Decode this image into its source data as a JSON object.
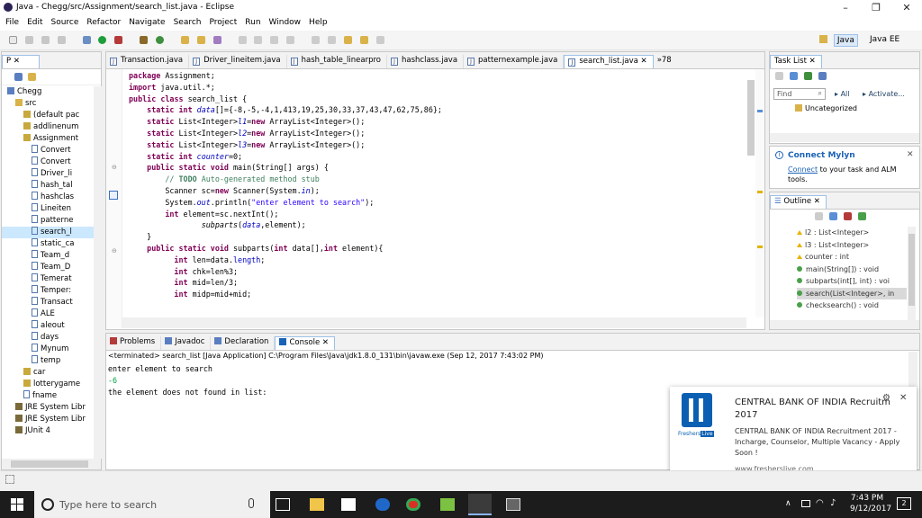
{
  "window": {
    "title": "Java - Chegg/src/Assignment/search_list.java - Eclipse"
  },
  "menu": [
    "File",
    "Edit",
    "Source",
    "Refactor",
    "Navigate",
    "Search",
    "Project",
    "Run",
    "Window",
    "Help"
  ],
  "perspectives": {
    "java": "Java",
    "javaee": "Java EE"
  },
  "explorer": {
    "tab": "P",
    "items": [
      {
        "label": "Chegg",
        "type": "project",
        "indent": 0
      },
      {
        "label": "src",
        "type": "folder",
        "indent": 1
      },
      {
        "label": "(default pac",
        "type": "package",
        "indent": 2
      },
      {
        "label": "addlinenum",
        "type": "package",
        "indent": 2
      },
      {
        "label": "Assignment",
        "type": "package",
        "indent": 2
      },
      {
        "label": "Convert",
        "type": "file",
        "indent": 3
      },
      {
        "label": "Convert",
        "type": "file",
        "indent": 3
      },
      {
        "label": "Driver_li",
        "type": "file",
        "indent": 3
      },
      {
        "label": "hash_tal",
        "type": "file",
        "indent": 3
      },
      {
        "label": "hashclas",
        "type": "file",
        "indent": 3
      },
      {
        "label": "Lineiten",
        "type": "file",
        "indent": 3
      },
      {
        "label": "patterne",
        "type": "file",
        "indent": 3
      },
      {
        "label": "search_l",
        "type": "file",
        "indent": 3,
        "selected": true
      },
      {
        "label": "static_ca",
        "type": "file",
        "indent": 3
      },
      {
        "label": "Team_d",
        "type": "file",
        "indent": 3
      },
      {
        "label": "Team_D",
        "type": "file",
        "indent": 3
      },
      {
        "label": "Temerat",
        "type": "file",
        "indent": 3
      },
      {
        "label": "Temper:",
        "type": "file",
        "indent": 3
      },
      {
        "label": "Transact",
        "type": "file",
        "indent": 3
      },
      {
        "label": "ALE",
        "type": "file",
        "indent": 3
      },
      {
        "label": "aleout",
        "type": "file",
        "indent": 3
      },
      {
        "label": "days",
        "type": "file",
        "indent": 3
      },
      {
        "label": "Mynum",
        "type": "file",
        "indent": 3
      },
      {
        "label": "temp",
        "type": "file",
        "indent": 3
      },
      {
        "label": "car",
        "type": "package",
        "indent": 2
      },
      {
        "label": "lotterygame",
        "type": "package",
        "indent": 2
      },
      {
        "label": "fname",
        "type": "file",
        "indent": 2
      },
      {
        "label": "JRE System Libr",
        "type": "lib",
        "indent": 1
      },
      {
        "label": "JRE System Libr",
        "type": "lib",
        "indent": 1
      },
      {
        "label": "JUnit 4",
        "type": "lib",
        "indent": 1
      }
    ]
  },
  "editor": {
    "tabs": [
      {
        "label": "Transaction.java",
        "active": false
      },
      {
        "label": "Driver_lineitem.java",
        "active": false
      },
      {
        "label": "hash_table_linearpro",
        "active": false
      },
      {
        "label": "hashclass.java",
        "active": false
      },
      {
        "label": "patternexample.java",
        "active": false
      },
      {
        "label": "search_list.java",
        "active": true
      }
    ],
    "overflow": "»78"
  },
  "tasklist": {
    "tab": "Task List",
    "find_placeholder": "Find",
    "all": "All",
    "activate": "Activate...",
    "uncategorized": "Uncategorized"
  },
  "mylyn": {
    "title": "Connect Mylyn",
    "link": "Connect",
    "text": " to your task and ALM tools."
  },
  "outline": {
    "tab": "Outline",
    "items": [
      {
        "label": "l2 : List<Integer>",
        "vis": "default",
        "color": "#ecb000"
      },
      {
        "label": "l3 : List<Integer>",
        "vis": "default",
        "color": "#ecb000"
      },
      {
        "label": "counter : int",
        "vis": "default",
        "color": "#ecb000"
      },
      {
        "label": "main(String[]) : void",
        "vis": "public",
        "color": "#4aa04a"
      },
      {
        "label": "subparts(int[], int) : voi",
        "vis": "public",
        "color": "#4aa04a"
      },
      {
        "label": "search(List<Integer>, in",
        "vis": "public",
        "color": "#4aa04a",
        "selected": true
      },
      {
        "label": "checksearch() : void",
        "vis": "public",
        "color": "#4aa04a"
      }
    ]
  },
  "bottom": {
    "tabs": [
      "Problems",
      "Javadoc",
      "Declaration",
      "Console"
    ],
    "active": "Console",
    "console_header": "<terminated> search_list [Java Application] C:\\Program Files\\Java\\jdk1.8.0_131\\bin\\javaw.exe (Sep 12, 2017 7:43:02 PM)",
    "lines": [
      "enter element to search",
      "-6",
      "the element does not found in list:"
    ]
  },
  "notification": {
    "title": "CENTRAL BANK OF INDIA Recruitm",
    "subtitle": "2017",
    "body": "CENTRAL BANK OF INDIA Recruitment 2017 - Incharge, Counselor, Multiple Vacancy - Apply Soon !",
    "site": "www.fresherslive.com",
    "brand": "Freshers",
    "brand2": "Live"
  },
  "taskbar": {
    "search_placeholder": "Type here to search",
    "time": "7:43 PM",
    "date": "9/12/2017",
    "notif_count": "2"
  },
  "colors": {
    "accent": "#0078d7",
    "selection": "#cce8ff",
    "taskbar": "#1c1c1c"
  }
}
